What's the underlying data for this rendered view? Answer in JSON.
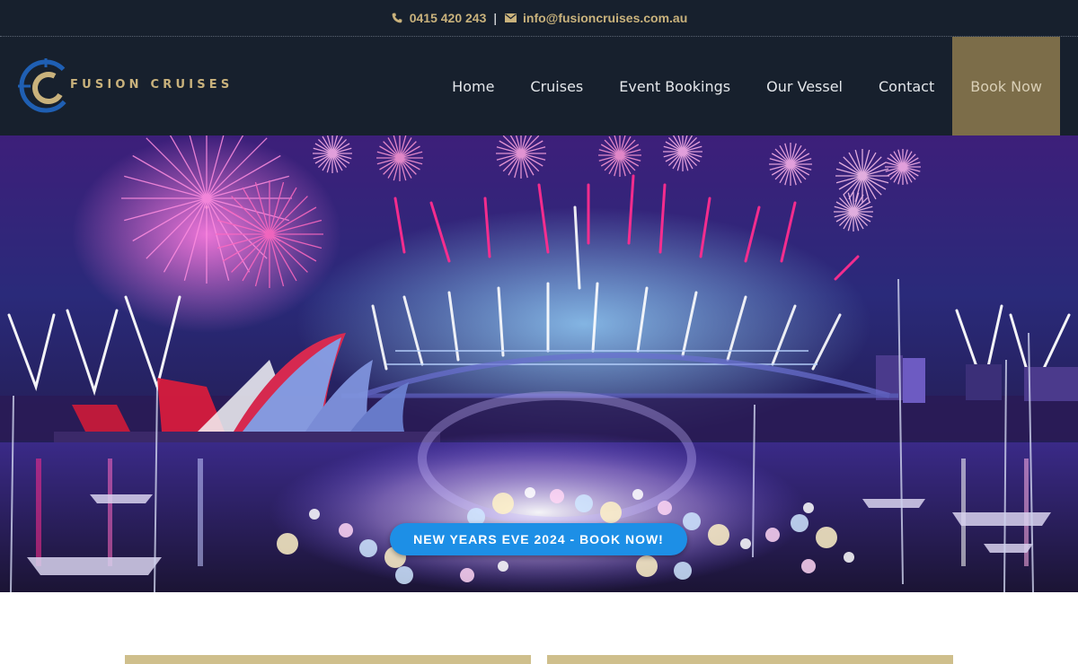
{
  "topbar": {
    "phone": "0415 420 243",
    "separator": "|",
    "email": "info@fusioncruises.com.au",
    "phone_icon": "phone-icon",
    "email_icon": "envelope-icon"
  },
  "header": {
    "logo_text": "FUSION CRUISES",
    "nav": [
      {
        "label": "Home"
      },
      {
        "label": "Cruises"
      },
      {
        "label": "Event Bookings"
      },
      {
        "label": "Our Vessel"
      },
      {
        "label": "Contact"
      },
      {
        "label": "Book Now"
      }
    ]
  },
  "hero": {
    "cta_label": "NEW YEARS EVE 2024 - BOOK NOW!"
  },
  "colors": {
    "navy": "#17202d",
    "gold": "#c9b27c",
    "book_bg": "#7c6d49",
    "cta_blue": "#1d8fe6",
    "logo_blue": "#1f5fb3"
  }
}
